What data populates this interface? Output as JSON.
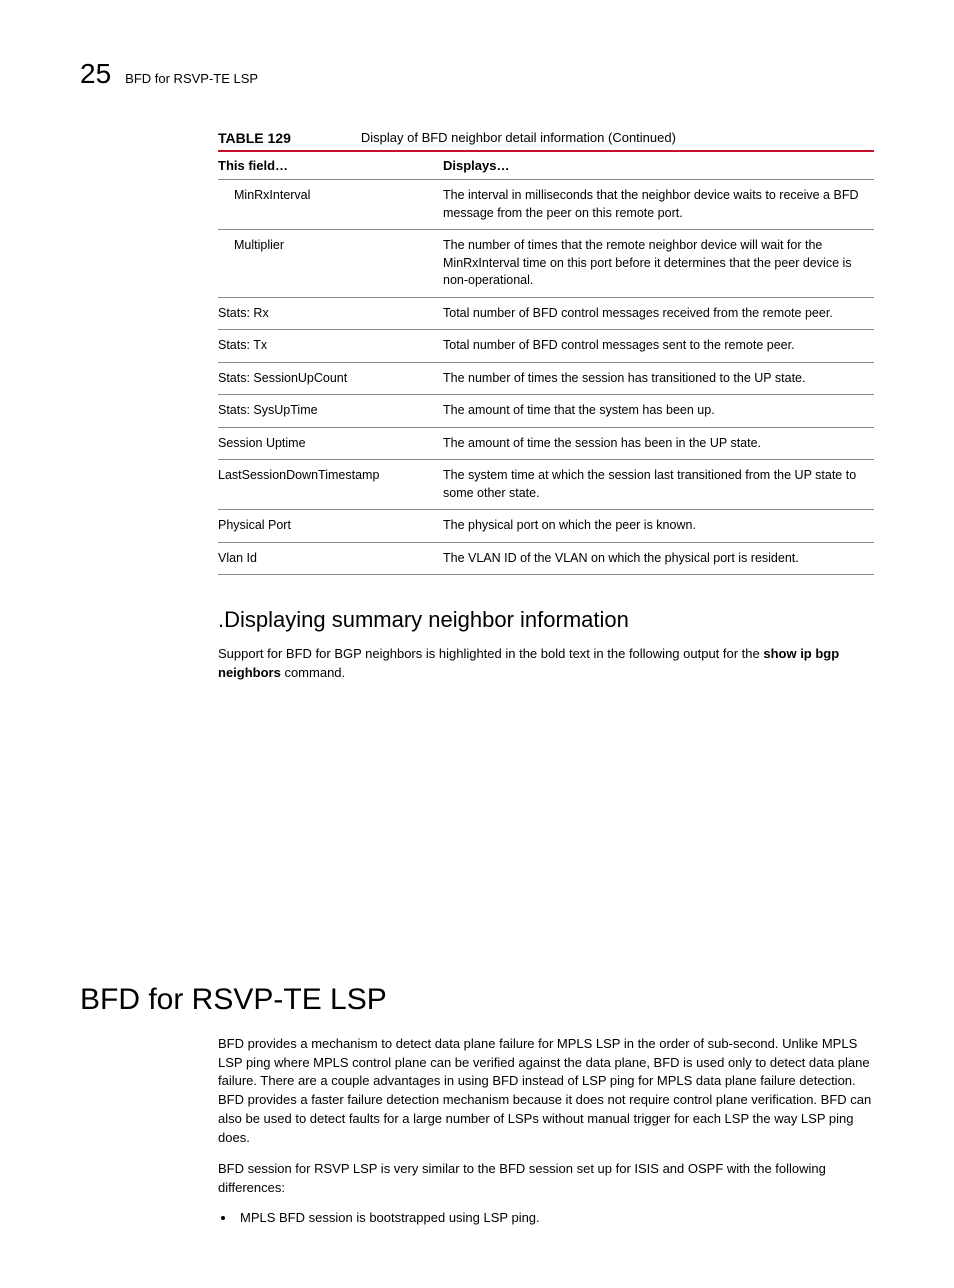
{
  "header": {
    "chapter_number": "25",
    "running_title": "BFD for RSVP-TE LSP"
  },
  "table": {
    "label": "TABLE 129",
    "caption": "Display of BFD neighbor detail information (Continued)",
    "head_col1": "This field…",
    "head_col2": "Displays…",
    "rows": [
      {
        "field": "MinRxInterval",
        "indent": true,
        "desc": "The interval in milliseconds that the neighbor device waits to receive a BFD message from the peer on this remote port."
      },
      {
        "field": "Multiplier",
        "indent": true,
        "desc": "The number of times that the remote neighbor device will wait for the MinRxInterval time on this port before it determines that the peer device is non-operational."
      },
      {
        "field": "Stats: Rx",
        "indent": false,
        "desc": "Total number of BFD control messages received from the remote peer."
      },
      {
        "field": "Stats: Tx",
        "indent": false,
        "desc": "Total number of BFD control messages sent to the remote peer."
      },
      {
        "field": "Stats: SessionUpCount",
        "indent": false,
        "desc": "The number of times the session has transitioned to the UP state."
      },
      {
        "field": "Stats: SysUpTime",
        "indent": false,
        "desc": "The amount of time that the system has been up."
      },
      {
        "field": "Session Uptime",
        "indent": false,
        "desc": "The amount of time the session has been in the UP state."
      },
      {
        "field": "LastSessionDownTimestamp",
        "indent": false,
        "desc": "The system time at which the session last transitioned from the UP state to some other state."
      },
      {
        "field": "Physical Port",
        "indent": false,
        "desc": "The physical port on which the peer is known."
      },
      {
        "field": "Vlan Id",
        "indent": false,
        "desc": "The VLAN ID of the VLAN on which the physical port is resident."
      }
    ]
  },
  "subsection": {
    "heading": ".Displaying summary neighbor information",
    "para_pre": "Support for BFD for BGP neighbors is highlighted in the bold text in the following output for the ",
    "command_bold": "show ip bgp neighbors",
    "para_post": " command."
  },
  "section": {
    "heading": "BFD for RSVP-TE LSP",
    "p1": "BFD provides a mechanism to detect data plane failure for MPLS LSP in the order of sub-second. Unlike MPLS LSP ping where MPLS control plane can be verified against the data plane, BFD is used only to detect data plane failure. There are a couple advantages in using BFD instead of LSP ping for MPLS data plane failure detection. BFD provides a faster failure detection mechanism because it does not require control plane verification. BFD can also be used to detect faults for a large number of LSPs without manual trigger for each LSP the way LSP ping does.",
    "p2": "BFD session for RSVP LSP is very similar to the BFD session set up for ISIS and OSPF with the following differences:",
    "bullet1": "MPLS BFD session is bootstrapped using LSP ping."
  }
}
